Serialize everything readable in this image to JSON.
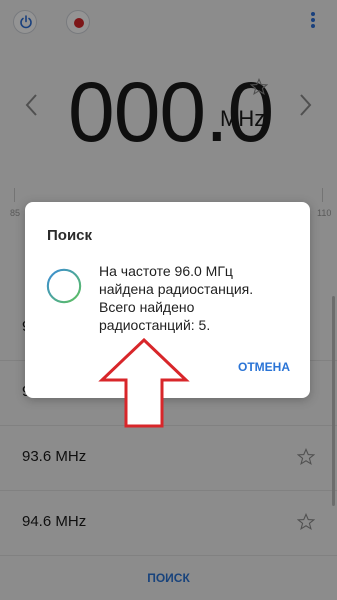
{
  "topbar": {
    "power_icon": "power-icon",
    "record_icon": "record-icon",
    "menu_icon": "more-vertical-icon",
    "accent_color": "#2c6ed8",
    "record_color": "#d8262a"
  },
  "tuner": {
    "frequency": "000.0",
    "unit": "MHz",
    "prev_icon": "chevron-left-icon",
    "next_icon": "chevron-right-icon",
    "favorite_icon": "star-outline-icon",
    "scale_labels": [
      "85",
      "110"
    ]
  },
  "stations": [
    {
      "label": "9"
    },
    {
      "label": "9"
    },
    {
      "label": "93.6 MHz"
    },
    {
      "label": "94.6 MHz"
    }
  ],
  "bottom": {
    "scan_label": "ПОИСК"
  },
  "dialog": {
    "title": "Поиск",
    "message_lines": [
      "На частоте 96.0 МГц",
      "найдена радиостанция.",
      "Всего найдено",
      "радиостанций: 5."
    ],
    "cancel_label": "ОТМЕНА",
    "spinner_colors": [
      "#3a8bd8",
      "#5fc15c"
    ]
  },
  "annotation": {
    "arrow_color": "#d8262a",
    "arrow_icon": "up-arrow-icon"
  }
}
